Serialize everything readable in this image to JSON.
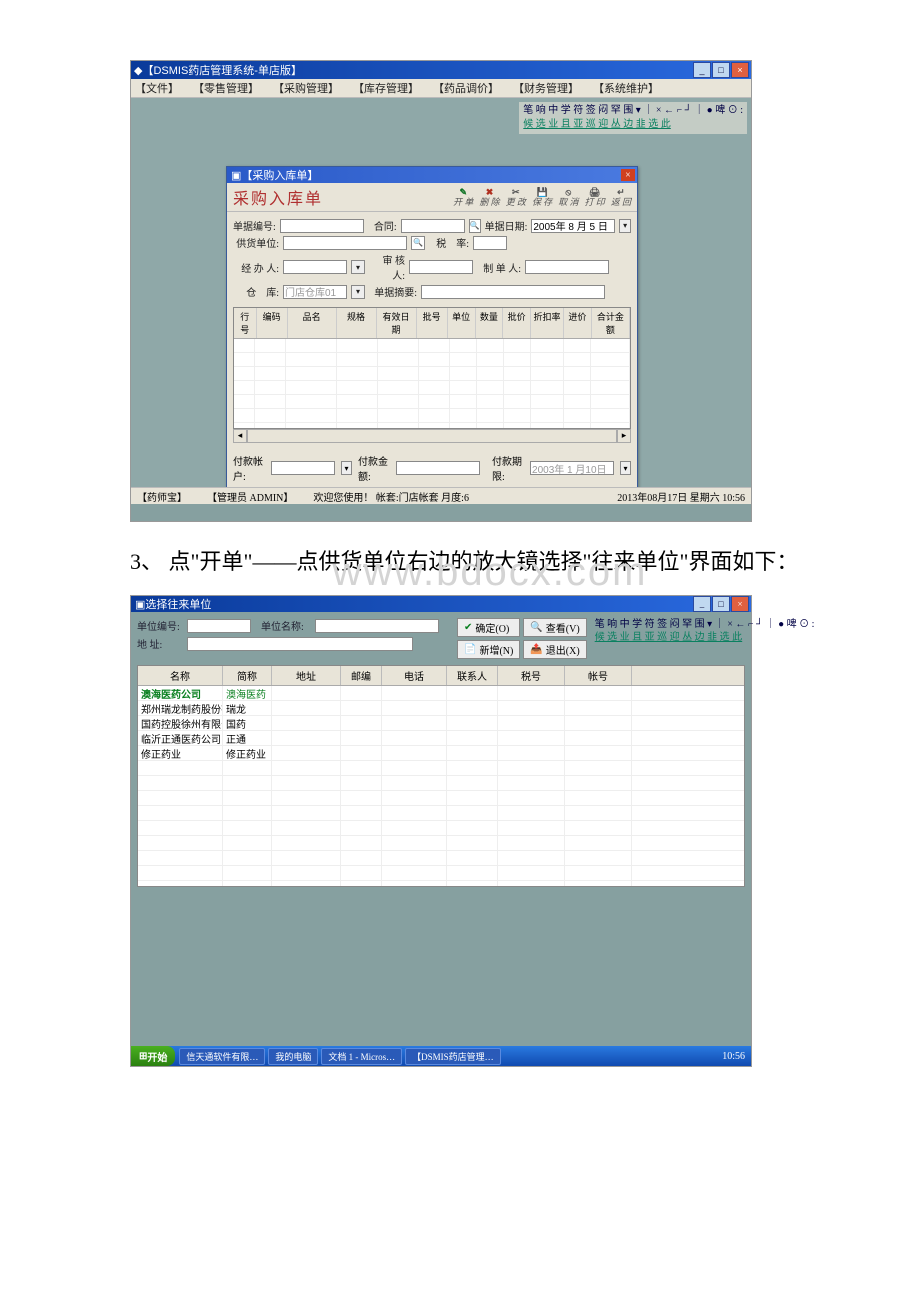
{
  "watermark": "www.bdocx.com",
  "instruction_text": "3、 点\"开单\"——点供货单位右边的放大镜选择\"往来单位\"界面如下：",
  "win1": {
    "title": "【DSMIS药店管理系统-单店版】",
    "menu": [
      "【文件】",
      "【零售管理】",
      "【采购管理】",
      "【库存管理】",
      "【药品调价】",
      "【财务管理】",
      "【系统维护】"
    ],
    "toolbox_line1": "笔 响 中 学 符 签 闷 罕 围 ▾ ｜ × ← ⌐ ┘ ｜ ● 啤 ⊙ :",
    "toolbox_line2": "候 选  业 且 亚 巡 迎 丛 边 韭 选 此",
    "modal": {
      "title": "【采购入库单】",
      "header_title": "采购入库单",
      "header_icons": [
        "开 单",
        "删 除",
        "更 改",
        "保 存",
        "取 消",
        "打 印",
        "返 回"
      ],
      "fields": {
        "doc_no_label": "单据编号:",
        "contract_label": "合同:",
        "date_label": "单据日期:",
        "date_value": "2005年 8 月 5 日",
        "supplier_label": "供货单位:",
        "tax_label": "税　率:",
        "handler_label": "经 办 人:",
        "auditor_label": "审 核 人:",
        "creator_label": "制 单 人:",
        "warehouse_label": "仓　库:",
        "warehouse_value": "门店仓库01",
        "summary_label": "单据摘要:"
      },
      "grid_cols": [
        "行号",
        "编码",
        "品名",
        "规格",
        "有效日期",
        "批号",
        "单位",
        "数量",
        "批价",
        "折扣率",
        "进价",
        "合计金额"
      ],
      "payment": {
        "acct_label": "付款帐户:",
        "amount_label": "付款金额:",
        "deadline_label": "付款期限:",
        "deadline_value": "2003年 1 月10日"
      }
    },
    "status": {
      "left1": "【药师宝】",
      "left2": "【管理员 ADMIN】",
      "left3": "欢迎您使用！ 帐套:门店帐套  月度:6",
      "right": "2013年08月17日 星期六    10:56"
    }
  },
  "win2": {
    "title": "选择往来单位",
    "filters": {
      "no_label": "单位编号:",
      "name_label": "单位名称:",
      "addr_label": "地    址:"
    },
    "buttons": {
      "ok": "确定(O)",
      "view": "查看(V)",
      "new": "新增(N)",
      "exit": "退出(X)"
    },
    "toolbox_line1": "笔 响 中 学 符 签 闷 罕 围 ▾ ｜ × ← ⌐ ┘ ｜ ● 啤 ⊙ :",
    "toolbox_line2": "候 选  业 且 亚 巡 迎 丛 边 韭 选 此",
    "grid_cols": [
      "名称",
      "简称",
      "地址",
      "邮编",
      "电话",
      "联系人",
      "税号",
      "帐号"
    ],
    "rows": [
      {
        "name": "澳海医药公司",
        "abbr": "澳海医药"
      },
      {
        "name": "郑州瑞龙制药股份有限公司",
        "abbr": "瑞龙"
      },
      {
        "name": "国药控股徐州有限公司",
        "abbr": "国药"
      },
      {
        "name": "临沂正通医药公司",
        "abbr": "正通"
      },
      {
        "name": "修正药业",
        "abbr": "修正药业"
      }
    ]
  },
  "taskbar": {
    "start": "开始",
    "items": [
      "信天通软件有限…",
      "我的电脑",
      "文档 1 - Micros…",
      "【DSMIS药店管理…"
    ],
    "time": "10:56"
  }
}
